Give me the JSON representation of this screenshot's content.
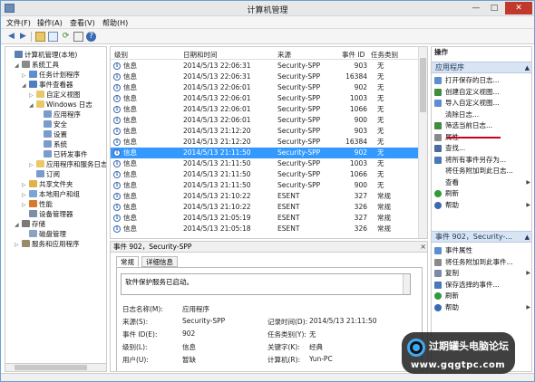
{
  "window": {
    "title": "计算机管理",
    "controls": {
      "minimize": "—",
      "maximize": "□",
      "close": "✕"
    }
  },
  "menubar": [
    "文件(F)",
    "操作(A)",
    "查看(V)",
    "帮助(H)"
  ],
  "toolbar_icons": [
    "back-icon",
    "forward-icon",
    "up-folder-icon",
    "console-tree-icon",
    "refresh-icon",
    "properties-icon",
    "help-icon",
    "pane-icon"
  ],
  "tree": [
    {
      "label": "计算机管理(本地)",
      "level": 0,
      "twist": "",
      "icon": "computer"
    },
    {
      "label": "系统工具",
      "level": 1,
      "twist": "◢",
      "icon": "tools"
    },
    {
      "label": "任务计划程序",
      "level": 2,
      "twist": "▷",
      "icon": "clock"
    },
    {
      "label": "事件查看器",
      "level": 2,
      "twist": "◢",
      "icon": "event"
    },
    {
      "label": "自定义视图",
      "level": 3,
      "twist": "▷",
      "icon": "folder"
    },
    {
      "label": "Windows 日志",
      "level": 3,
      "twist": "◢",
      "icon": "folder"
    },
    {
      "label": "应用程序",
      "level": 4,
      "twist": "",
      "icon": "log"
    },
    {
      "label": "安全",
      "level": 4,
      "twist": "",
      "icon": "log"
    },
    {
      "label": "设置",
      "level": 4,
      "twist": "",
      "icon": "log"
    },
    {
      "label": "系统",
      "level": 4,
      "twist": "",
      "icon": "log"
    },
    {
      "label": "已转发事件",
      "level": 4,
      "twist": "",
      "icon": "log"
    },
    {
      "label": "应用程序和服务日志",
      "level": 3,
      "twist": "▷",
      "icon": "folder"
    },
    {
      "label": "订阅",
      "level": 3,
      "twist": "",
      "icon": "log"
    },
    {
      "label": "共享文件夹",
      "level": 2,
      "twist": "▷",
      "icon": "share"
    },
    {
      "label": "本地用户和组",
      "level": 2,
      "twist": "▷",
      "icon": "users"
    },
    {
      "label": "性能",
      "level": 2,
      "twist": "▷",
      "icon": "perf"
    },
    {
      "label": "设备管理器",
      "level": 2,
      "twist": "",
      "icon": "device"
    },
    {
      "label": "存储",
      "level": 1,
      "twist": "◢",
      "icon": "storage"
    },
    {
      "label": "磁盘管理",
      "level": 2,
      "twist": "",
      "icon": "disk"
    },
    {
      "label": "服务和应用程序",
      "level": 1,
      "twist": "▷",
      "icon": "services"
    }
  ],
  "grid": {
    "headers": [
      "级别",
      "日期和时间",
      "来源",
      "事件 ID",
      "任务类别"
    ],
    "rows": [
      [
        "信息",
        "2014/5/13 22:06:31",
        "Security-SPP",
        "903",
        "无"
      ],
      [
        "信息",
        "2014/5/13 22:06:31",
        "Security-SPP",
        "16384",
        "无"
      ],
      [
        "信息",
        "2014/5/13 22:06:01",
        "Security-SPP",
        "902",
        "无"
      ],
      [
        "信息",
        "2014/5/13 22:06:01",
        "Security-SPP",
        "1003",
        "无"
      ],
      [
        "信息",
        "2014/5/13 22:06:01",
        "Security-SPP",
        "1066",
        "无"
      ],
      [
        "信息",
        "2014/5/13 22:06:01",
        "Security-SPP",
        "900",
        "无"
      ],
      [
        "信息",
        "2014/5/13 21:12:20",
        "Security-SPP",
        "903",
        "无"
      ],
      [
        "信息",
        "2014/5/13 21:12:20",
        "Security-SPP",
        "16384",
        "无"
      ],
      [
        "信息",
        "2014/5/13 21:11:50",
        "Security-SPP",
        "902",
        "无"
      ],
      [
        "信息",
        "2014/5/13 21:11:50",
        "Security-SPP",
        "1003",
        "无"
      ],
      [
        "信息",
        "2014/5/13 21:11:50",
        "Security-SPP",
        "1066",
        "无"
      ],
      [
        "信息",
        "2014/5/13 21:11:50",
        "Security-SPP",
        "900",
        "无"
      ],
      [
        "信息",
        "2014/5/13 21:10:22",
        "ESENT",
        "327",
        "常规"
      ],
      [
        "信息",
        "2014/5/13 21:10:22",
        "ESENT",
        "326",
        "常规"
      ],
      [
        "信息",
        "2014/5/13 21:05:19",
        "ESENT",
        "327",
        "常规"
      ],
      [
        "信息",
        "2014/5/13 21:05:18",
        "ESENT",
        "326",
        "常规"
      ]
    ],
    "selected_index": 8
  },
  "detail": {
    "header": "事件 902，Security-SPP",
    "close": "×",
    "tabs": [
      "常规",
      "详细信息"
    ],
    "message": "软件保护服务已启动。",
    "fields": [
      {
        "label": "日志名称(M):",
        "value": "应用程序"
      },
      {
        "label": "来源(S):",
        "value": "Security-SPP"
      },
      {
        "label": "记录时间(D):",
        "value": "2014/5/13 21:11:50"
      },
      {
        "label": "事件 ID(E):",
        "value": "902"
      },
      {
        "label": "任务类别(Y):",
        "value": "无"
      },
      {
        "label": "级别(L):",
        "value": "信息"
      },
      {
        "label": "关键字(K):",
        "value": "经典"
      },
      {
        "label": "用户(U):",
        "value": "暂缺"
      },
      {
        "label": "计算机(R):",
        "value": "Yun-PC"
      }
    ]
  },
  "actions": {
    "header": "操作",
    "section1": "应用程序",
    "items1": [
      {
        "label": "打开保存的日志...",
        "icon": "open-log-icon",
        "arrow": false
      },
      {
        "label": "创建自定义视图...",
        "icon": "filter-create-icon",
        "arrow": false
      },
      {
        "label": "导入自定义视图...",
        "icon": "import-icon",
        "arrow": false
      },
      {
        "label": "清除日志...",
        "icon": "",
        "arrow": false
      },
      {
        "label": "筛选当前日志...",
        "icon": "filter-icon",
        "arrow": false
      },
      {
        "label": "属性",
        "icon": "properties-icon",
        "arrow": false
      },
      {
        "label": "查找...",
        "icon": "find-icon",
        "arrow": false
      },
      {
        "label": "将所有事件另存为...",
        "icon": "save-icon",
        "arrow": false
      },
      {
        "label": "将任务附加到此日志...",
        "icon": "",
        "arrow": false
      },
      {
        "label": "查看",
        "icon": "",
        "arrow": true
      },
      {
        "label": "刷新",
        "icon": "refresh-icon",
        "arrow": false
      },
      {
        "label": "帮助",
        "icon": "help-icon",
        "arrow": true
      }
    ],
    "section2": "事件 902，Security-...",
    "items2": [
      {
        "label": "事件属性",
        "icon": "event-props-icon",
        "arrow": false
      },
      {
        "label": "将任务附加到此事件...",
        "icon": "attach-icon",
        "arrow": false
      },
      {
        "label": "复制",
        "icon": "copy-icon",
        "arrow": true
      },
      {
        "label": "保存选择的事件...",
        "icon": "save-icon",
        "arrow": false
      },
      {
        "label": "刷新",
        "icon": "refresh-icon",
        "arrow": false
      },
      {
        "label": "帮助",
        "icon": "help-icon",
        "arrow": true
      }
    ]
  },
  "watermark": {
    "line1": "过期罐头电脑论坛",
    "line2": "www.gqgtpc.com"
  },
  "colors": {
    "selection": "#3399ff",
    "section_bg": "#d8e4f3",
    "highlight_line": "#c8001e",
    "accent": "#6a9fd3"
  }
}
